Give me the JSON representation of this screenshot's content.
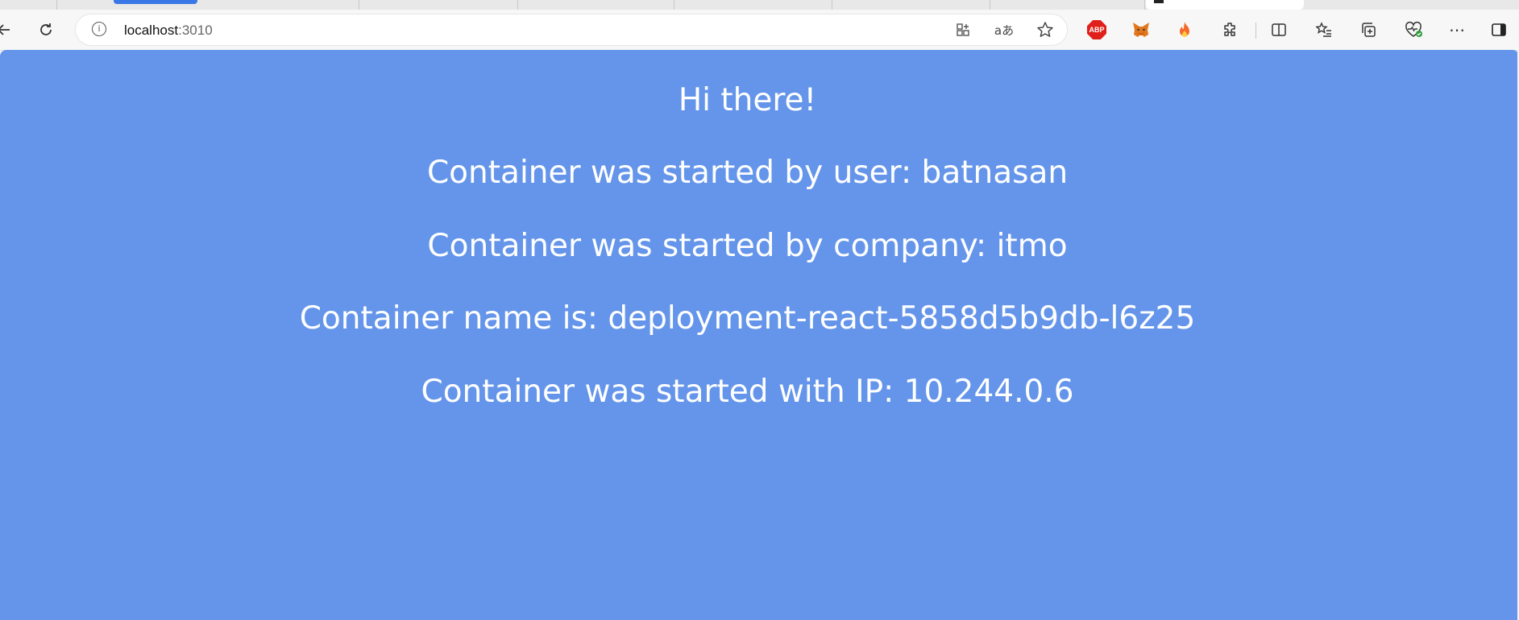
{
  "browser": {
    "address_bar": {
      "host": "localhost",
      "port": ":3010"
    },
    "icons": {
      "back": "back-arrow-icon",
      "refresh": "refresh-icon",
      "site_info": "info-icon",
      "app_available": "app-available-icon",
      "read_aloud": "translate-icon",
      "favorite": "star-icon",
      "adblock": "adblock-plus-icon",
      "metamask": "metamask-fox-icon",
      "flame_extension": "flame-icon",
      "extensions": "puzzle-icon",
      "split_screen": "split-screen-icon",
      "favorites": "favorites-list-icon",
      "collections": "collections-icon",
      "browser_essentials": "heart-pulse-icon",
      "more": "more-dots-icon",
      "sidebar": "sidebar-icon"
    },
    "adblock_label": "ABP"
  },
  "page": {
    "background_color": "#6495ea",
    "text_color": "#ffffff",
    "lines": {
      "greeting": "Hi there!",
      "user": "Container was started by user: batnasan",
      "company": "Container was started by company: itmo",
      "name": "Container name is: deployment-react-5858d5b9db-l6z25",
      "ip": "Container was started with IP: 10.244.0.6"
    }
  }
}
